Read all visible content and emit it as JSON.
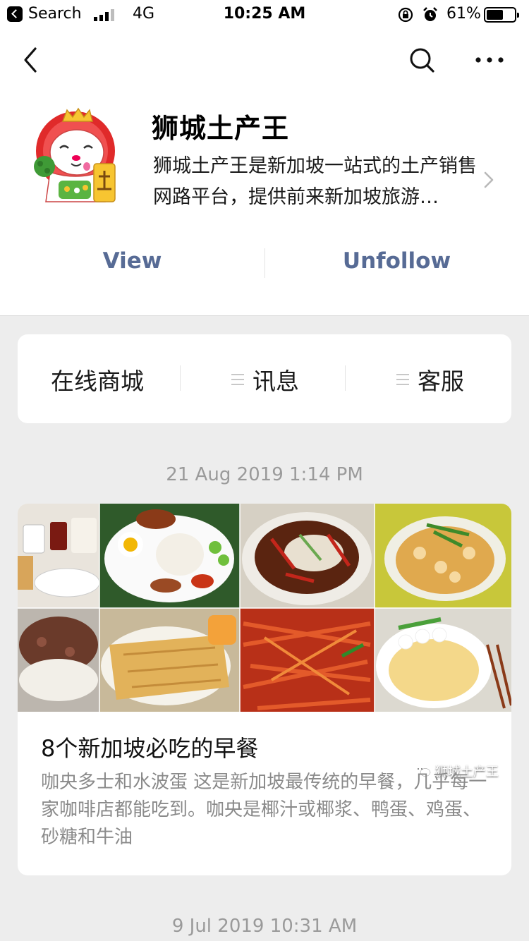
{
  "status_bar": {
    "back_app": "Search",
    "network": "4G",
    "time": "10:25 AM",
    "battery": "61%",
    "battery_level": 0.61
  },
  "account": {
    "name": "狮城土产王",
    "description": "狮城土产王是新加坡一站式的土产销售网路平台，提供前来新加坡旅游…",
    "actions": {
      "view": "View",
      "unfollow": "Unfollow"
    }
  },
  "menu": [
    "在线商城",
    "讯息",
    "客服"
  ],
  "feed": [
    {
      "timestamp": "21 Aug 2019 1:14 PM",
      "title": "8个新加坡必吃的早餐",
      "summary": "咖央多士和水波蛋 这是新加坡最传统的早餐，几乎每一家咖啡店都能吃到。咖央是椰汁或椰浆、鸭蛋、鸡蛋、砂糖和牛油",
      "watermark": "狮城土产王"
    },
    {
      "timestamp": "9 Jul 2019 10:31 AM"
    }
  ],
  "colors": {
    "link": "#576b95",
    "background": "#ededed",
    "muted": "#9a9a9a"
  }
}
